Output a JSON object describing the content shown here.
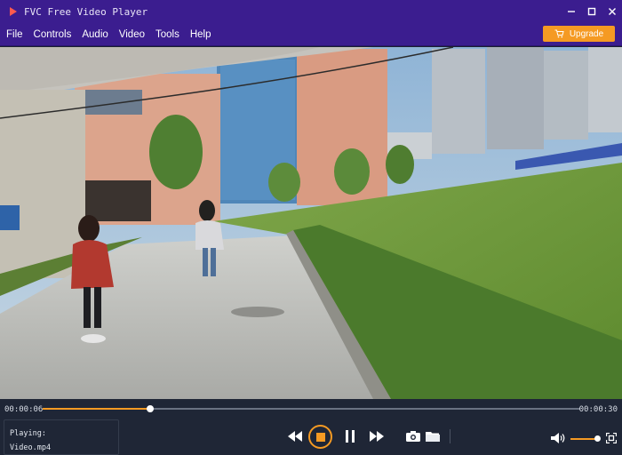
{
  "window": {
    "title": "FVC Free Video Player",
    "controls": [
      "minimize-icon",
      "maximize-icon",
      "close-icon"
    ]
  },
  "menu": {
    "items": [
      "File",
      "Controls",
      "Audio",
      "Video",
      "Tools",
      "Help"
    ],
    "upgrade_label": "Upgrade",
    "upgrade_icon": "cart-icon"
  },
  "colors": {
    "accent": "#f59a23",
    "titlebar": "#3b1d8f",
    "panel": "#1f2636"
  },
  "player": {
    "current_time": "00:00:06",
    "total_time": "00:00:30",
    "progress": 0.2,
    "volume": 0.9,
    "playing_label": "Playing:",
    "file_name": "Video.mp4"
  },
  "controls": [
    "rewind-icon",
    "stop-icon",
    "pause-icon",
    "fast-forward-icon",
    "snapshot-icon",
    "open-folder-icon",
    "volume-icon",
    "fullscreen-icon"
  ]
}
